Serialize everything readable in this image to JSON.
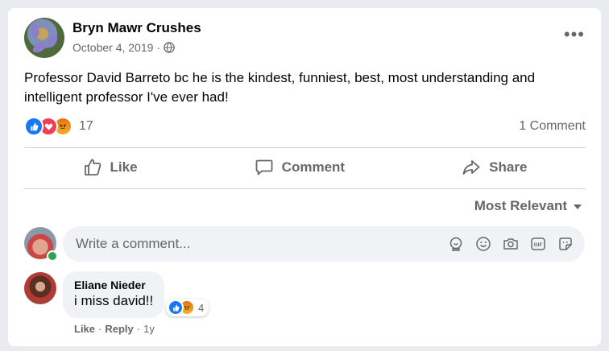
{
  "post": {
    "page_name": "Bryn Mawr Crushes",
    "date": "October 4, 2019",
    "meta_separator": "·",
    "more_label": "•••",
    "text": "Professor David Barreto bc he is the kindest, funniest, best, most understanding and intelligent professor I've ever had!",
    "reaction_count": "17",
    "reaction_types": [
      "like-icon",
      "love-icon",
      "angry-icon"
    ],
    "comment_count": "1 Comment"
  },
  "actions": {
    "like": "Like",
    "comment": "Comment",
    "share": "Share"
  },
  "comments_sort": "Most Relevant",
  "composer": {
    "placeholder": "Write a comment...",
    "icons": [
      "avatar-sticker-icon",
      "emoji-icon",
      "camera-icon",
      "gif-icon",
      "sticker-icon"
    ]
  },
  "comment": {
    "author": "Eliane Nieder",
    "text": "i miss david!!",
    "reaction_count": "4",
    "reaction_types": [
      "like-icon",
      "angry-icon"
    ],
    "like_label": "Like",
    "reply_label": "Reply",
    "separator": "·",
    "age": "1y"
  },
  "colors": {
    "background": "#e9ebee",
    "secondary_text": "#65676b",
    "like_blue": "#1877f2",
    "love_red": "#f33e58",
    "online_green": "#31a24c"
  }
}
